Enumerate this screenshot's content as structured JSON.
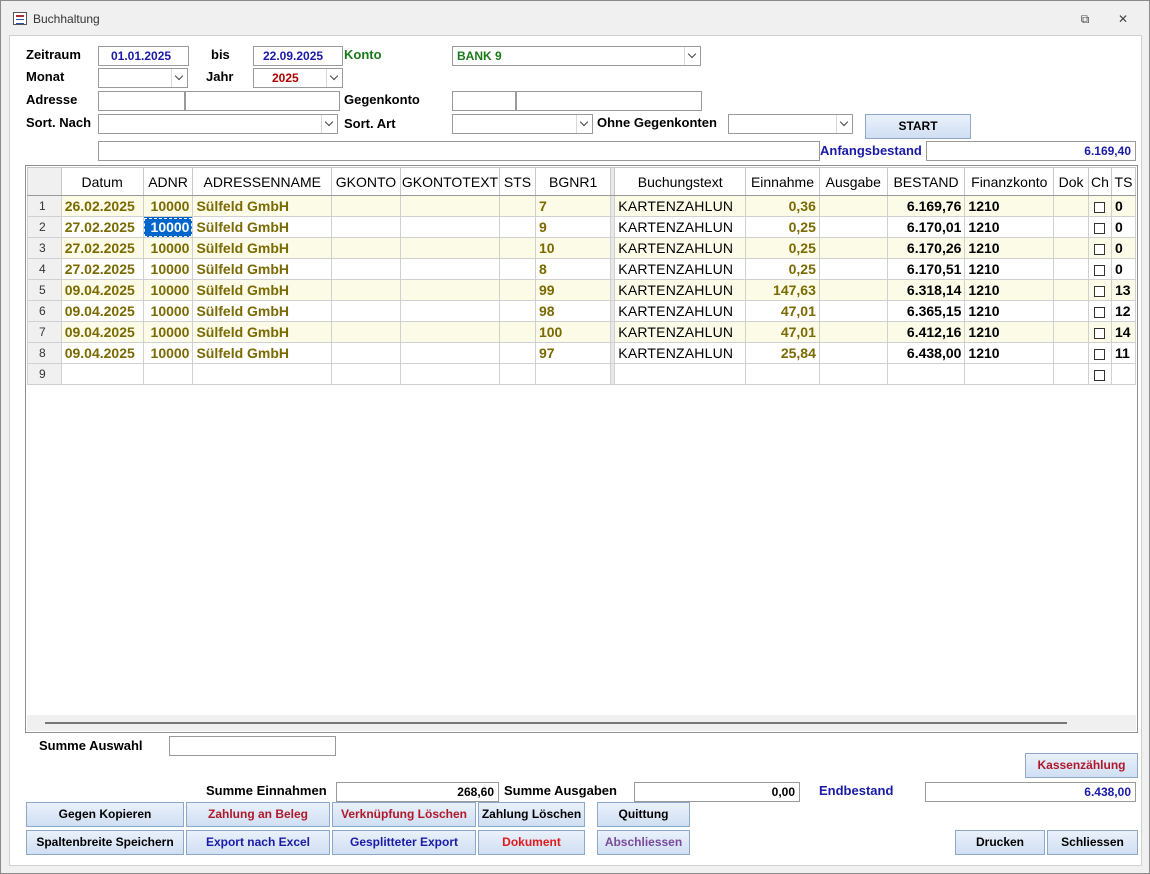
{
  "window": {
    "title": "Buchhaltung",
    "restore_glyph": "⧉",
    "close_glyph": "✕"
  },
  "filters": {
    "zeitraum_label": "Zeitraum",
    "date_from": "01.01.2025",
    "bis_label": "bis",
    "date_to": "22.09.2025",
    "konto_label": "Konto",
    "konto_value": "BANK 9",
    "monat_label": "Monat",
    "monat_value": "",
    "jahr_label": "Jahr",
    "jahr_value": "2025",
    "adresse_label": "Adresse",
    "adresse_nr": "",
    "adresse_name": "",
    "gegenkonto_label": "Gegenkonto",
    "gegenkonto_nr": "",
    "gegenkonto_name": "",
    "sort_nach_label": "Sort. Nach",
    "sort_nach_value": "",
    "sort_art_label": "Sort. Art",
    "sort_art_value": "",
    "ohne_gegenkonten_label": "Ohne Gegenkonten",
    "ohne_gegenkonten_value": "",
    "start_label": "START",
    "search_text": "",
    "anfangsbestand_label": "Anfangsbestand",
    "anfangsbestand_value": "6.169,40"
  },
  "grid": {
    "columns": [
      "Datum",
      "ADNR",
      "ADRESSENNAME",
      "GKONTO",
      "GKONTOTEXT",
      "STS",
      "BGNR1",
      "Buchungstext",
      "Einnahme",
      "Ausgabe",
      "BESTAND",
      "Finanzkonto",
      "Dok",
      "Ch",
      "TS"
    ],
    "rows": [
      {
        "n": "1",
        "datum": "26.02.2025",
        "adnr": "10000",
        "name": "Sülfeld GmbH",
        "gkonto": "",
        "gktext": "",
        "sts": "",
        "bgnr": "7",
        "text": "KARTENZAHLUN",
        "ein": "0,36",
        "aus": "",
        "bestand": "6.169,76",
        "fk": "1210",
        "dok": "",
        "ts": "0"
      },
      {
        "n": "2",
        "datum": "27.02.2025",
        "adnr": "10000",
        "name": "Sülfeld GmbH",
        "gkonto": "",
        "gktext": "",
        "sts": "",
        "bgnr": "9",
        "text": "KARTENZAHLUN",
        "ein": "0,25",
        "aus": "",
        "bestand": "6.170,01",
        "fk": "1210",
        "dok": "",
        "ts": "0"
      },
      {
        "n": "3",
        "datum": "27.02.2025",
        "adnr": "10000",
        "name": "Sülfeld GmbH",
        "gkonto": "",
        "gktext": "",
        "sts": "",
        "bgnr": "10",
        "text": "KARTENZAHLUN",
        "ein": "0,25",
        "aus": "",
        "bestand": "6.170,26",
        "fk": "1210",
        "dok": "",
        "ts": "0"
      },
      {
        "n": "4",
        "datum": "27.02.2025",
        "adnr": "10000",
        "name": "Sülfeld GmbH",
        "gkonto": "",
        "gktext": "",
        "sts": "",
        "bgnr": "8",
        "text": "KARTENZAHLUN",
        "ein": "0,25",
        "aus": "",
        "bestand": "6.170,51",
        "fk": "1210",
        "dok": "",
        "ts": "0"
      },
      {
        "n": "5",
        "datum": "09.04.2025",
        "adnr": "10000",
        "name": "Sülfeld GmbH",
        "gkonto": "",
        "gktext": "",
        "sts": "",
        "bgnr": "99",
        "text": "KARTENZAHLUN",
        "ein": "147,63",
        "aus": "",
        "bestand": "6.318,14",
        "fk": "1210",
        "dok": "",
        "ts": "13"
      },
      {
        "n": "6",
        "datum": "09.04.2025",
        "adnr": "10000",
        "name": "Sülfeld GmbH",
        "gkonto": "",
        "gktext": "",
        "sts": "",
        "bgnr": "98",
        "text": "KARTENZAHLUN",
        "ein": "47,01",
        "aus": "",
        "bestand": "6.365,15",
        "fk": "1210",
        "dok": "",
        "ts": "12"
      },
      {
        "n": "7",
        "datum": "09.04.2025",
        "adnr": "10000",
        "name": "Sülfeld GmbH",
        "gkonto": "",
        "gktext": "",
        "sts": "",
        "bgnr": "100",
        "text": "KARTENZAHLUN",
        "ein": "47,01",
        "aus": "",
        "bestand": "6.412,16",
        "fk": "1210",
        "dok": "",
        "ts": "14"
      },
      {
        "n": "8",
        "datum": "09.04.2025",
        "adnr": "10000",
        "name": "Sülfeld GmbH",
        "gkonto": "",
        "gktext": "",
        "sts": "",
        "bgnr": "97",
        "text": "KARTENZAHLUN",
        "ein": "25,84",
        "aus": "",
        "bestand": "6.438,00",
        "fk": "1210",
        "dok": "",
        "ts": "11"
      }
    ],
    "new_row_number": "9",
    "selected_row": 1
  },
  "summary": {
    "summe_auswahl_label": "Summe Auswahl",
    "summe_auswahl_value": "",
    "summe_einnahmen_label": "Summe Einnahmen",
    "summe_einnahmen_value": "268,60",
    "summe_ausgaben_label": "Summe Ausgaben",
    "summe_ausgaben_value": "0,00",
    "endbestand_label": "Endbestand",
    "endbestand_value": "6.438,00"
  },
  "buttons": {
    "kassenzaehlung": "Kassenzählung",
    "gegen_kopieren": "Gegen Kopieren",
    "zahlung_an_beleg": "Zahlung an Beleg",
    "verknuepfung_loeschen": "Verknüpfung Löschen",
    "zahlung_loeschen": "Zahlung Löschen",
    "quittung": "Quittung",
    "spaltenbreite_speichern": "Spaltenbreite Speichern",
    "export_nach_excel": "Export nach Excel",
    "gesplitteter_export": "Gesplitteter Export",
    "dokument": "Dokument",
    "abschliessen": "Abschliessen",
    "drucken": "Drucken",
    "schliessen": "Schliessen"
  },
  "colors": {
    "label_blue": "#1a1aa6",
    "konto_green": "#1a7a1a",
    "jahr_red": "#b00000",
    "row_olive": "#7a6a00",
    "odd_row_bg": "#fcfbe8",
    "selection": "#0066cc"
  }
}
